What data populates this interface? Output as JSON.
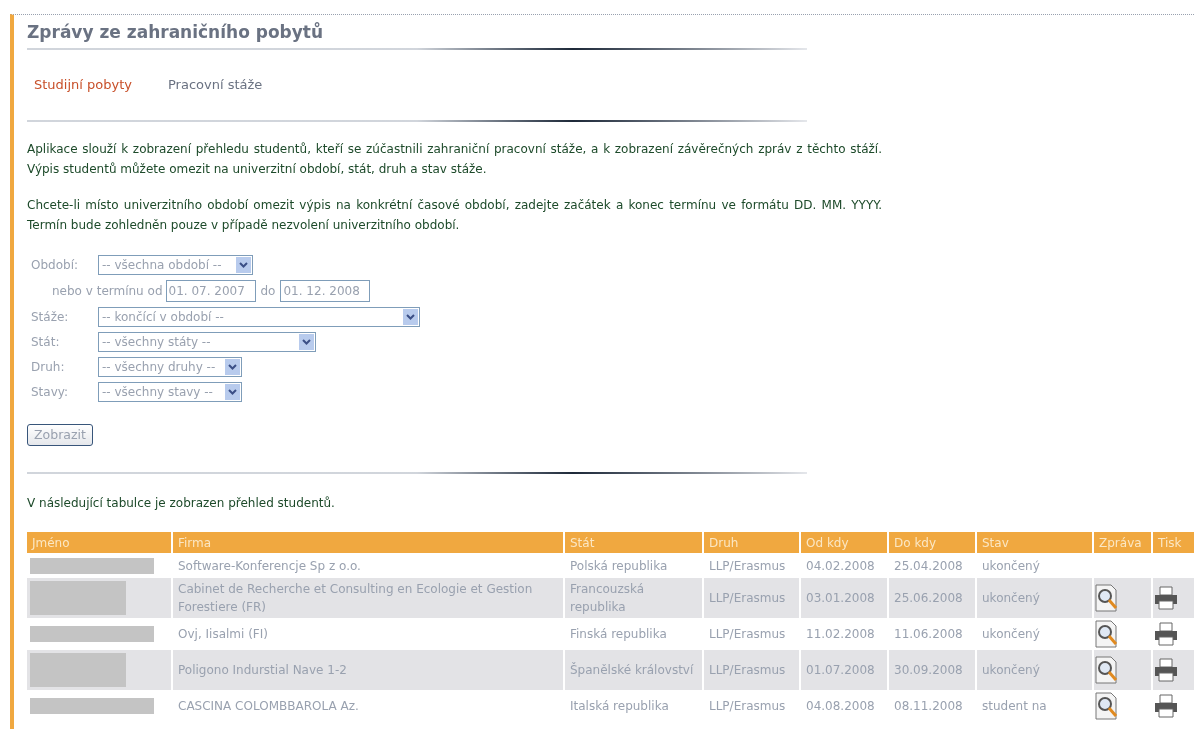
{
  "title": "Zprávy ze zahraničního pobytů",
  "tabs": [
    {
      "label": "Studijní pobyty",
      "selected": true
    },
    {
      "label": "Pracovní stáže",
      "selected": false
    }
  ],
  "intro": [
    "Aplikace slouží k zobrazení přehledu studentů, kteří se zúčastnili zahraniční pracovní stáže, a k zobrazení závěrečných zpráv z těchto stáží. Výpis studentů můžete omezit na univerzitní období, stát, druh a stav stáže.",
    "Chcete-li místo univerzitního období omezit výpis na konkrétní časové období, zadejte začátek a konec termínu ve formátu DD. MM. YYYY. Termín bude zohledněn pouze v případě nezvolení univerzitního období."
  ],
  "form": {
    "period": {
      "label": "Období:",
      "value": "-- všechna období --"
    },
    "range": {
      "label_from": "nebo v termínu od",
      "from": "01. 07. 2007",
      "label_to": "do",
      "to": "01. 12. 2008"
    },
    "selects": [
      {
        "label": "Stáže:",
        "value": "-- končící v období --"
      },
      {
        "label": "Stát:",
        "value": "-- všechny státy --"
      },
      {
        "label": "Druh:",
        "value": "-- všechny druhy --"
      },
      {
        "label": "Stavy:",
        "value": "-- všechny stavy --"
      }
    ],
    "submit": "Zobrazit"
  },
  "table_caption": "V následující tabulce je zobrazen přehled studentů.",
  "table": {
    "columns": [
      "Jméno",
      "Firma",
      "Stát",
      "Druh",
      "Od kdy",
      "Do kdy",
      "Stav",
      "Zpráva",
      "Tisk"
    ],
    "rows": [
      {
        "firma": "Software-Konferencje Sp z o.o.",
        "stat": "Polská republika",
        "druh": "LLP/Erasmus",
        "od": "04.02.2008",
        "do": "25.04.2008",
        "stav": "ukončený",
        "has_report": false
      },
      {
        "firma": "Cabinet de Recherche et Consulting en Ecologie et Gestion Forestiere (FR)",
        "stat": "Francouzská republika",
        "druh": "LLP/Erasmus",
        "od": "03.01.2008",
        "do": "25.06.2008",
        "stav": "ukončený",
        "has_report": true
      },
      {
        "firma": "Ovj, Iisalmi (FI)",
        "stat": "Finská republika",
        "druh": "LLP/Erasmus",
        "od": "11.02.2008",
        "do": "11.06.2008",
        "stav": "ukončený",
        "has_report": true
      },
      {
        "firma": "Poligono Indurstial Nave 1-2",
        "stat": "Španělské království",
        "druh": "LLP/Erasmus",
        "od": "01.07.2008",
        "do": "30.09.2008",
        "stav": "ukončený",
        "has_report": true
      },
      {
        "firma": "CASCINA COLOMBBAROLA Az.",
        "stat": "Italská republika",
        "druh": "LLP/Erasmus",
        "od": "04.08.2008",
        "do": "08.11.2008",
        "stav": "student na",
        "has_report": true
      }
    ]
  }
}
